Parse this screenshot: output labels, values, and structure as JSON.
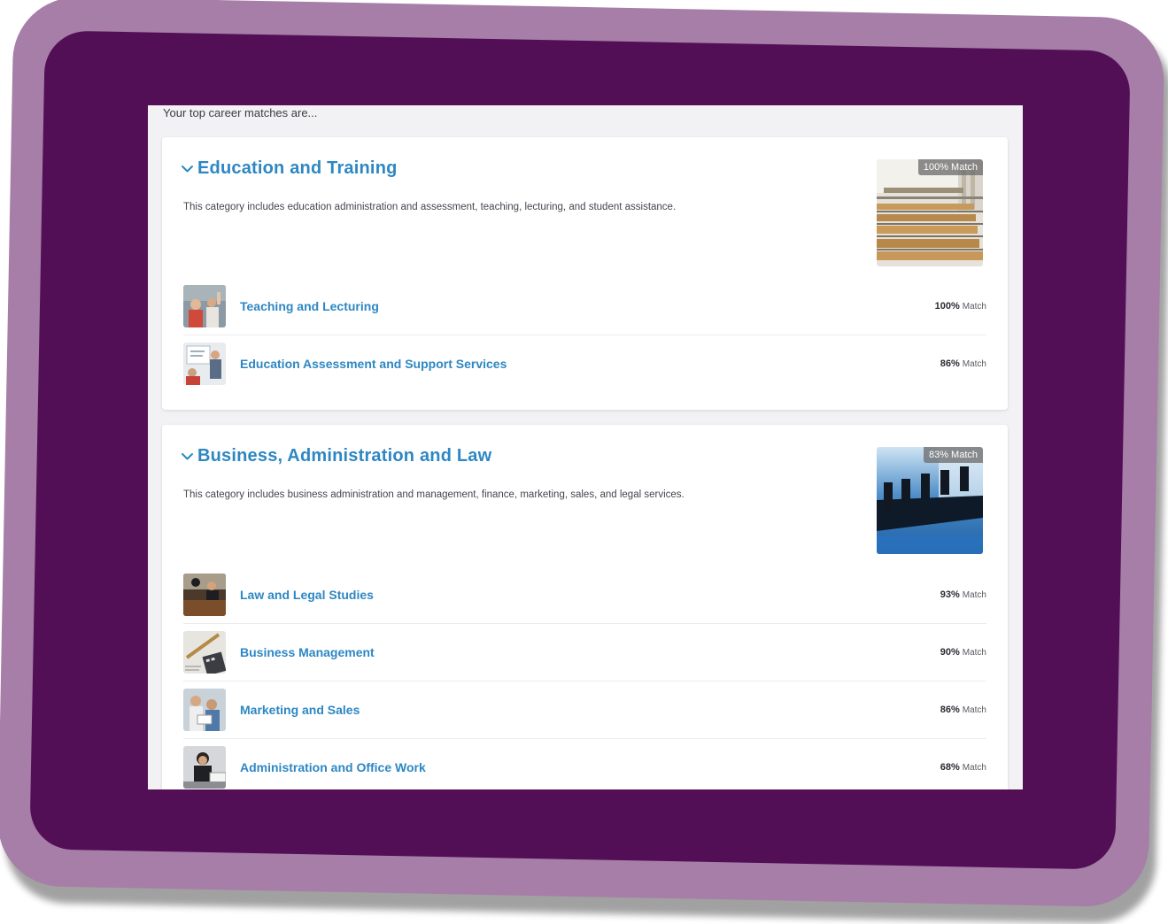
{
  "intro_text": "Your top career matches are...",
  "colors": {
    "frame_outer": "#a67ea8",
    "frame_inner": "#520f55",
    "link_blue": "#2d87c3"
  },
  "categories": [
    {
      "title": "Education and Training",
      "description": "This category includes education administration and assessment, teaching, lecturing, and student assistance.",
      "match_badge": "100% Match",
      "image": "lecture-hall-photo",
      "subcategories": [
        {
          "name": "Teaching and Lecturing",
          "match_pct": "100%",
          "match_label": "Match",
          "image": "classroom-photo"
        },
        {
          "name": "Education Assessment and Support Services",
          "match_pct": "86%",
          "match_label": "Match",
          "image": "whiteboard-presentation-photo"
        }
      ]
    },
    {
      "title": "Business, Administration and Law",
      "description": "This category includes business administration and management, finance, marketing, sales, and legal services.",
      "match_badge": "83% Match",
      "image": "boardroom-photo",
      "subcategories": [
        {
          "name": "Law and Legal Studies",
          "match_pct": "93%",
          "match_label": "Match",
          "image": "courtroom-photo"
        },
        {
          "name": "Business Management",
          "match_pct": "90%",
          "match_label": "Match",
          "image": "calculator-pen-photo"
        },
        {
          "name": "Marketing and Sales",
          "match_pct": "86%",
          "match_label": "Match",
          "image": "sales-meeting-photo"
        },
        {
          "name": "Administration and Office Work",
          "match_pct": "68%",
          "match_label": "Match",
          "image": "office-worker-photo"
        }
      ]
    }
  ]
}
